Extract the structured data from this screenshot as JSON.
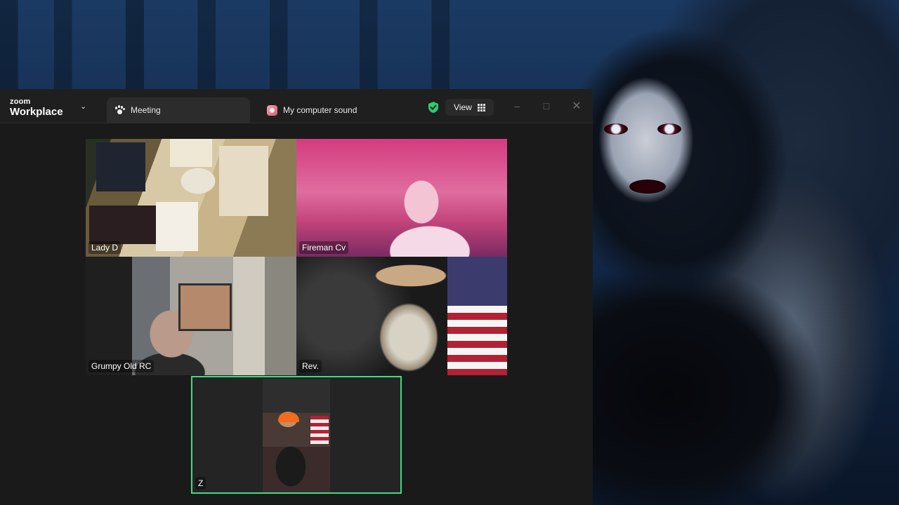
{
  "app": {
    "brand_top": "zoom",
    "brand_bottom": "Workplace"
  },
  "tabs": [
    {
      "label": "Meeting",
      "icon": "paw-icon",
      "active": true
    },
    {
      "label": "My computer sound",
      "icon": "sound-share-icon",
      "active": false
    }
  ],
  "toolbar": {
    "security_icon": "shield-check-icon",
    "view_label": "View",
    "view_icon": "grid-icon"
  },
  "window_controls": [
    "minimize",
    "maximize",
    "close"
  ],
  "participants": [
    {
      "name": "Lady D"
    },
    {
      "name": "Fireman Cv"
    },
    {
      "name": "Grumpy Old RC"
    },
    {
      "name": "Rev."
    },
    {
      "name": "Z",
      "active_speaker": true
    }
  ],
  "colors": {
    "active_speaker_border": "#3ddc84",
    "shield_green": "#2ecc71",
    "window_bg": "#1a1a1a"
  }
}
